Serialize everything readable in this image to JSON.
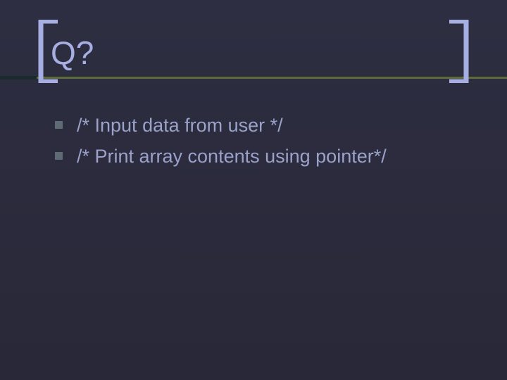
{
  "title": "Q?",
  "items": [
    {
      "text": "/* Input data from user */"
    },
    {
      "text": "/* Print array contents using pointer*/"
    }
  ]
}
